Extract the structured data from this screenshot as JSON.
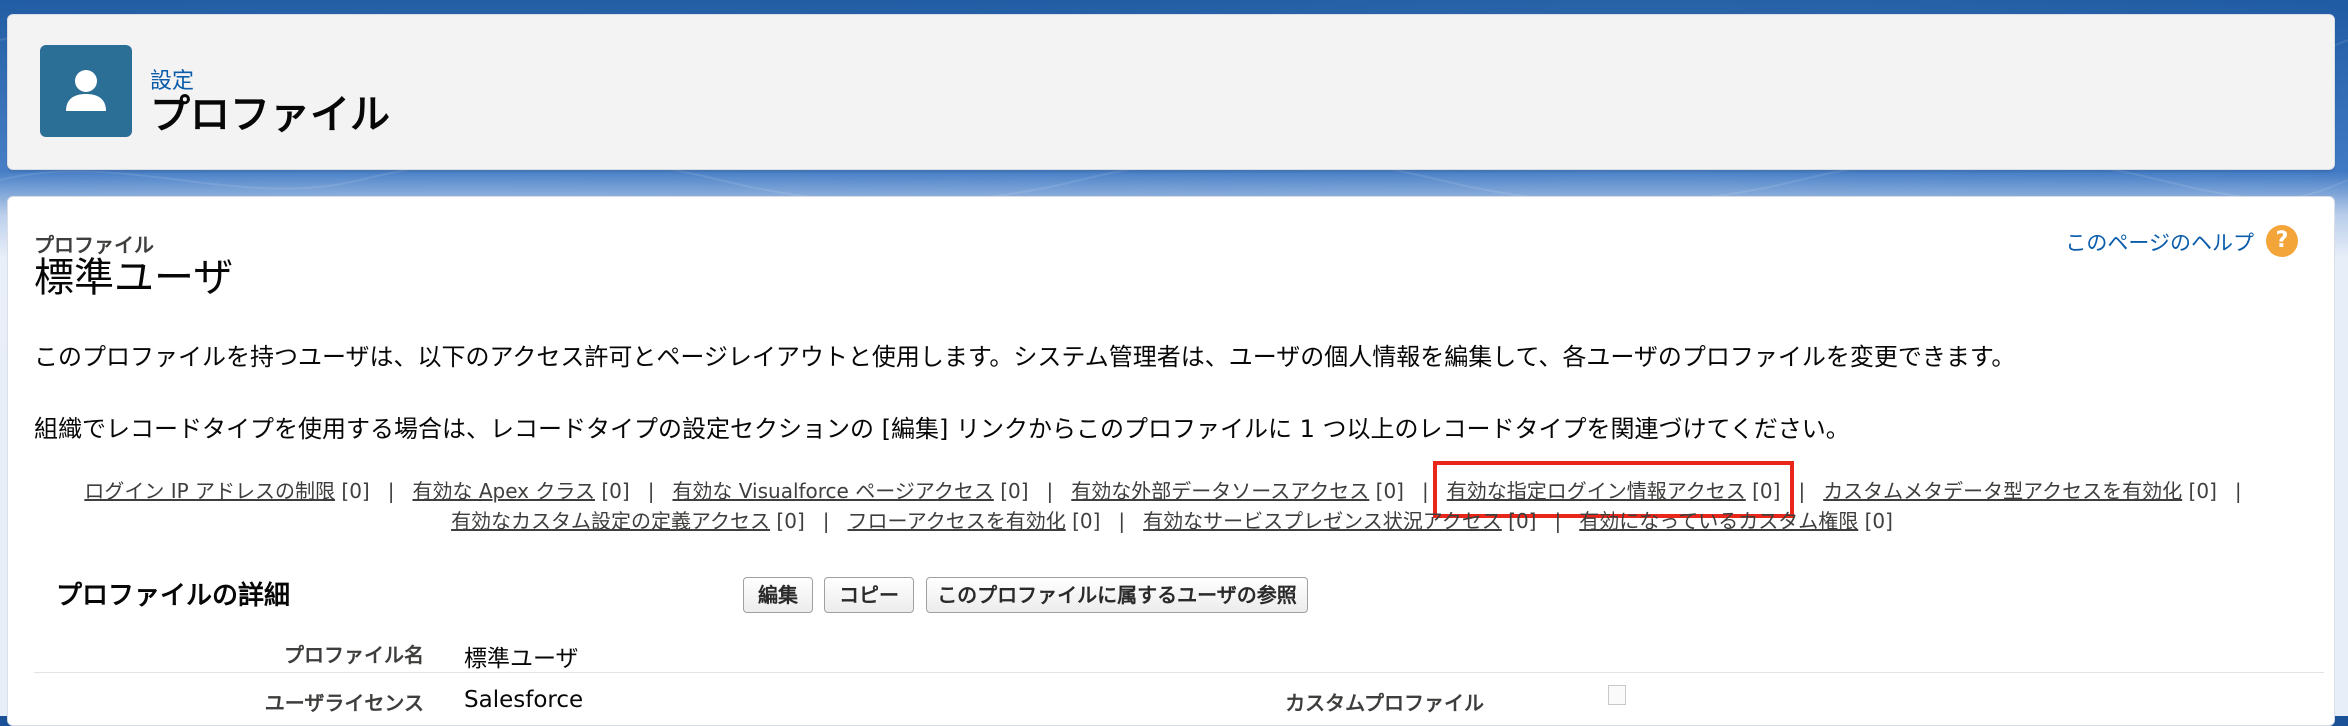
{
  "header": {
    "breadcrumb": "設定",
    "title": "プロファイル",
    "icon": "user-icon"
  },
  "page": {
    "type_label": "プロファイル",
    "name": "標準ユーザ",
    "help_link": "このページのヘルプ",
    "help_icon": "?"
  },
  "description": {
    "line1": "このプロファイルを持つユーザは、以下のアクセス許可とページレイアウトと使用します。システム管理者は、ユーザの個人情報を編集して、各ユーザのプロファイルを変更できます。",
    "line2": "組織でレコードタイプを使用する場合は、レコードタイプの設定セクションの [編集] リンクからこのプロファイルに 1 つ以上のレコードタイプを関連づけてください。"
  },
  "related_links": {
    "separator": "|",
    "row1": [
      {
        "label": "ログイン IP アドレスの制限",
        "count": "[0]"
      },
      {
        "label": "有効な Apex クラス",
        "count": "[0]"
      },
      {
        "label": "有効な Visualforce ページアクセス",
        "count": "[0]"
      },
      {
        "label": "有効な外部データソースアクセス",
        "count": "[0]"
      },
      {
        "label": "有効な指定ログイン情報アクセス",
        "count": "[0]"
      },
      {
        "label": "カスタムメタデータ型アクセスを有効化",
        "count": "[0]"
      }
    ],
    "row2": [
      {
        "label": "有効なカスタム設定の定義アクセス",
        "count": "[0]"
      },
      {
        "label": "フローアクセスを有効化",
        "count": "[0]"
      },
      {
        "label": "有効なサービスプレゼンス状況アクセス",
        "count": "[0]"
      },
      {
        "label": "有効になっているカスタム権限",
        "count": "[0]"
      }
    ]
  },
  "detail_section": {
    "title": "プロファイルの詳細",
    "buttons": {
      "edit": "編集",
      "copy": "コピー",
      "view_users": "このプロファイルに属するユーザの参照"
    },
    "fields": {
      "profile_name_label": "プロファイル名",
      "profile_name_value": "標準ユーザ",
      "user_license_label": "ユーザライセンス",
      "user_license_value": "Salesforce",
      "custom_profile_label": "カスタムプロファイル",
      "custom_profile_checked": false
    }
  },
  "colors": {
    "accent": "#0b5cab",
    "icon_bg": "#2b6f97",
    "highlight": "#e8271a",
    "help_icon": "#f4a53a"
  }
}
